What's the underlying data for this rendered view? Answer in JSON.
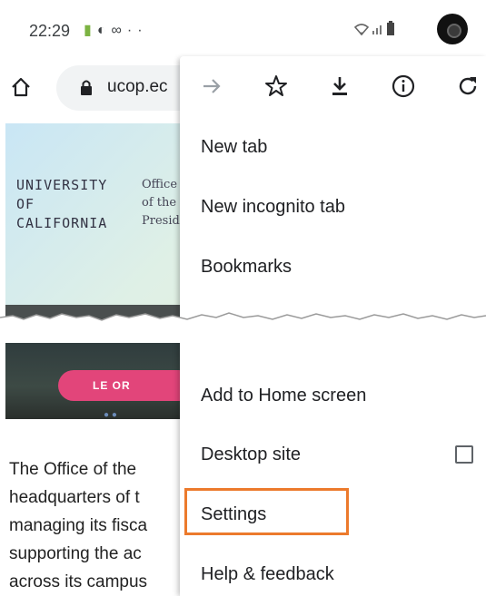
{
  "status_bar": {
    "time": "22:29",
    "left_icons": [
      "android-icon",
      "sync-icon",
      "infinity-icon",
      "more-dots-icon"
    ],
    "right_icons": [
      "wifi-icon",
      "signal-icon",
      "battery-icon"
    ],
    "more_dots": "··"
  },
  "url_bar": {
    "url_text": "ucop.ec"
  },
  "page": {
    "logo_university": "UNIVERSITY\nOF\nCALIFORNIA",
    "logo_office": "Office\nof the\nPresid",
    "banner_text": "LE    OR",
    "body_text": "The Office of the\nheadquarters of t\nmanaging its fisca\nsupporting the ac\nacross its campus"
  },
  "menu": {
    "top_items": [
      {
        "label": "New tab"
      },
      {
        "label": "New incognito tab"
      },
      {
        "label": "Bookmarks"
      }
    ],
    "bottom_items": [
      {
        "label": "Add to Home screen"
      },
      {
        "label": "Desktop site"
      },
      {
        "label": "Settings"
      },
      {
        "label": "Help & feedback"
      }
    ],
    "desktop_site_checked": false,
    "highlighted_item": "Settings"
  },
  "colors": {
    "highlight": "#ec7a2c",
    "banner_pink": "#e2457a",
    "android_green": "#7cb342"
  }
}
